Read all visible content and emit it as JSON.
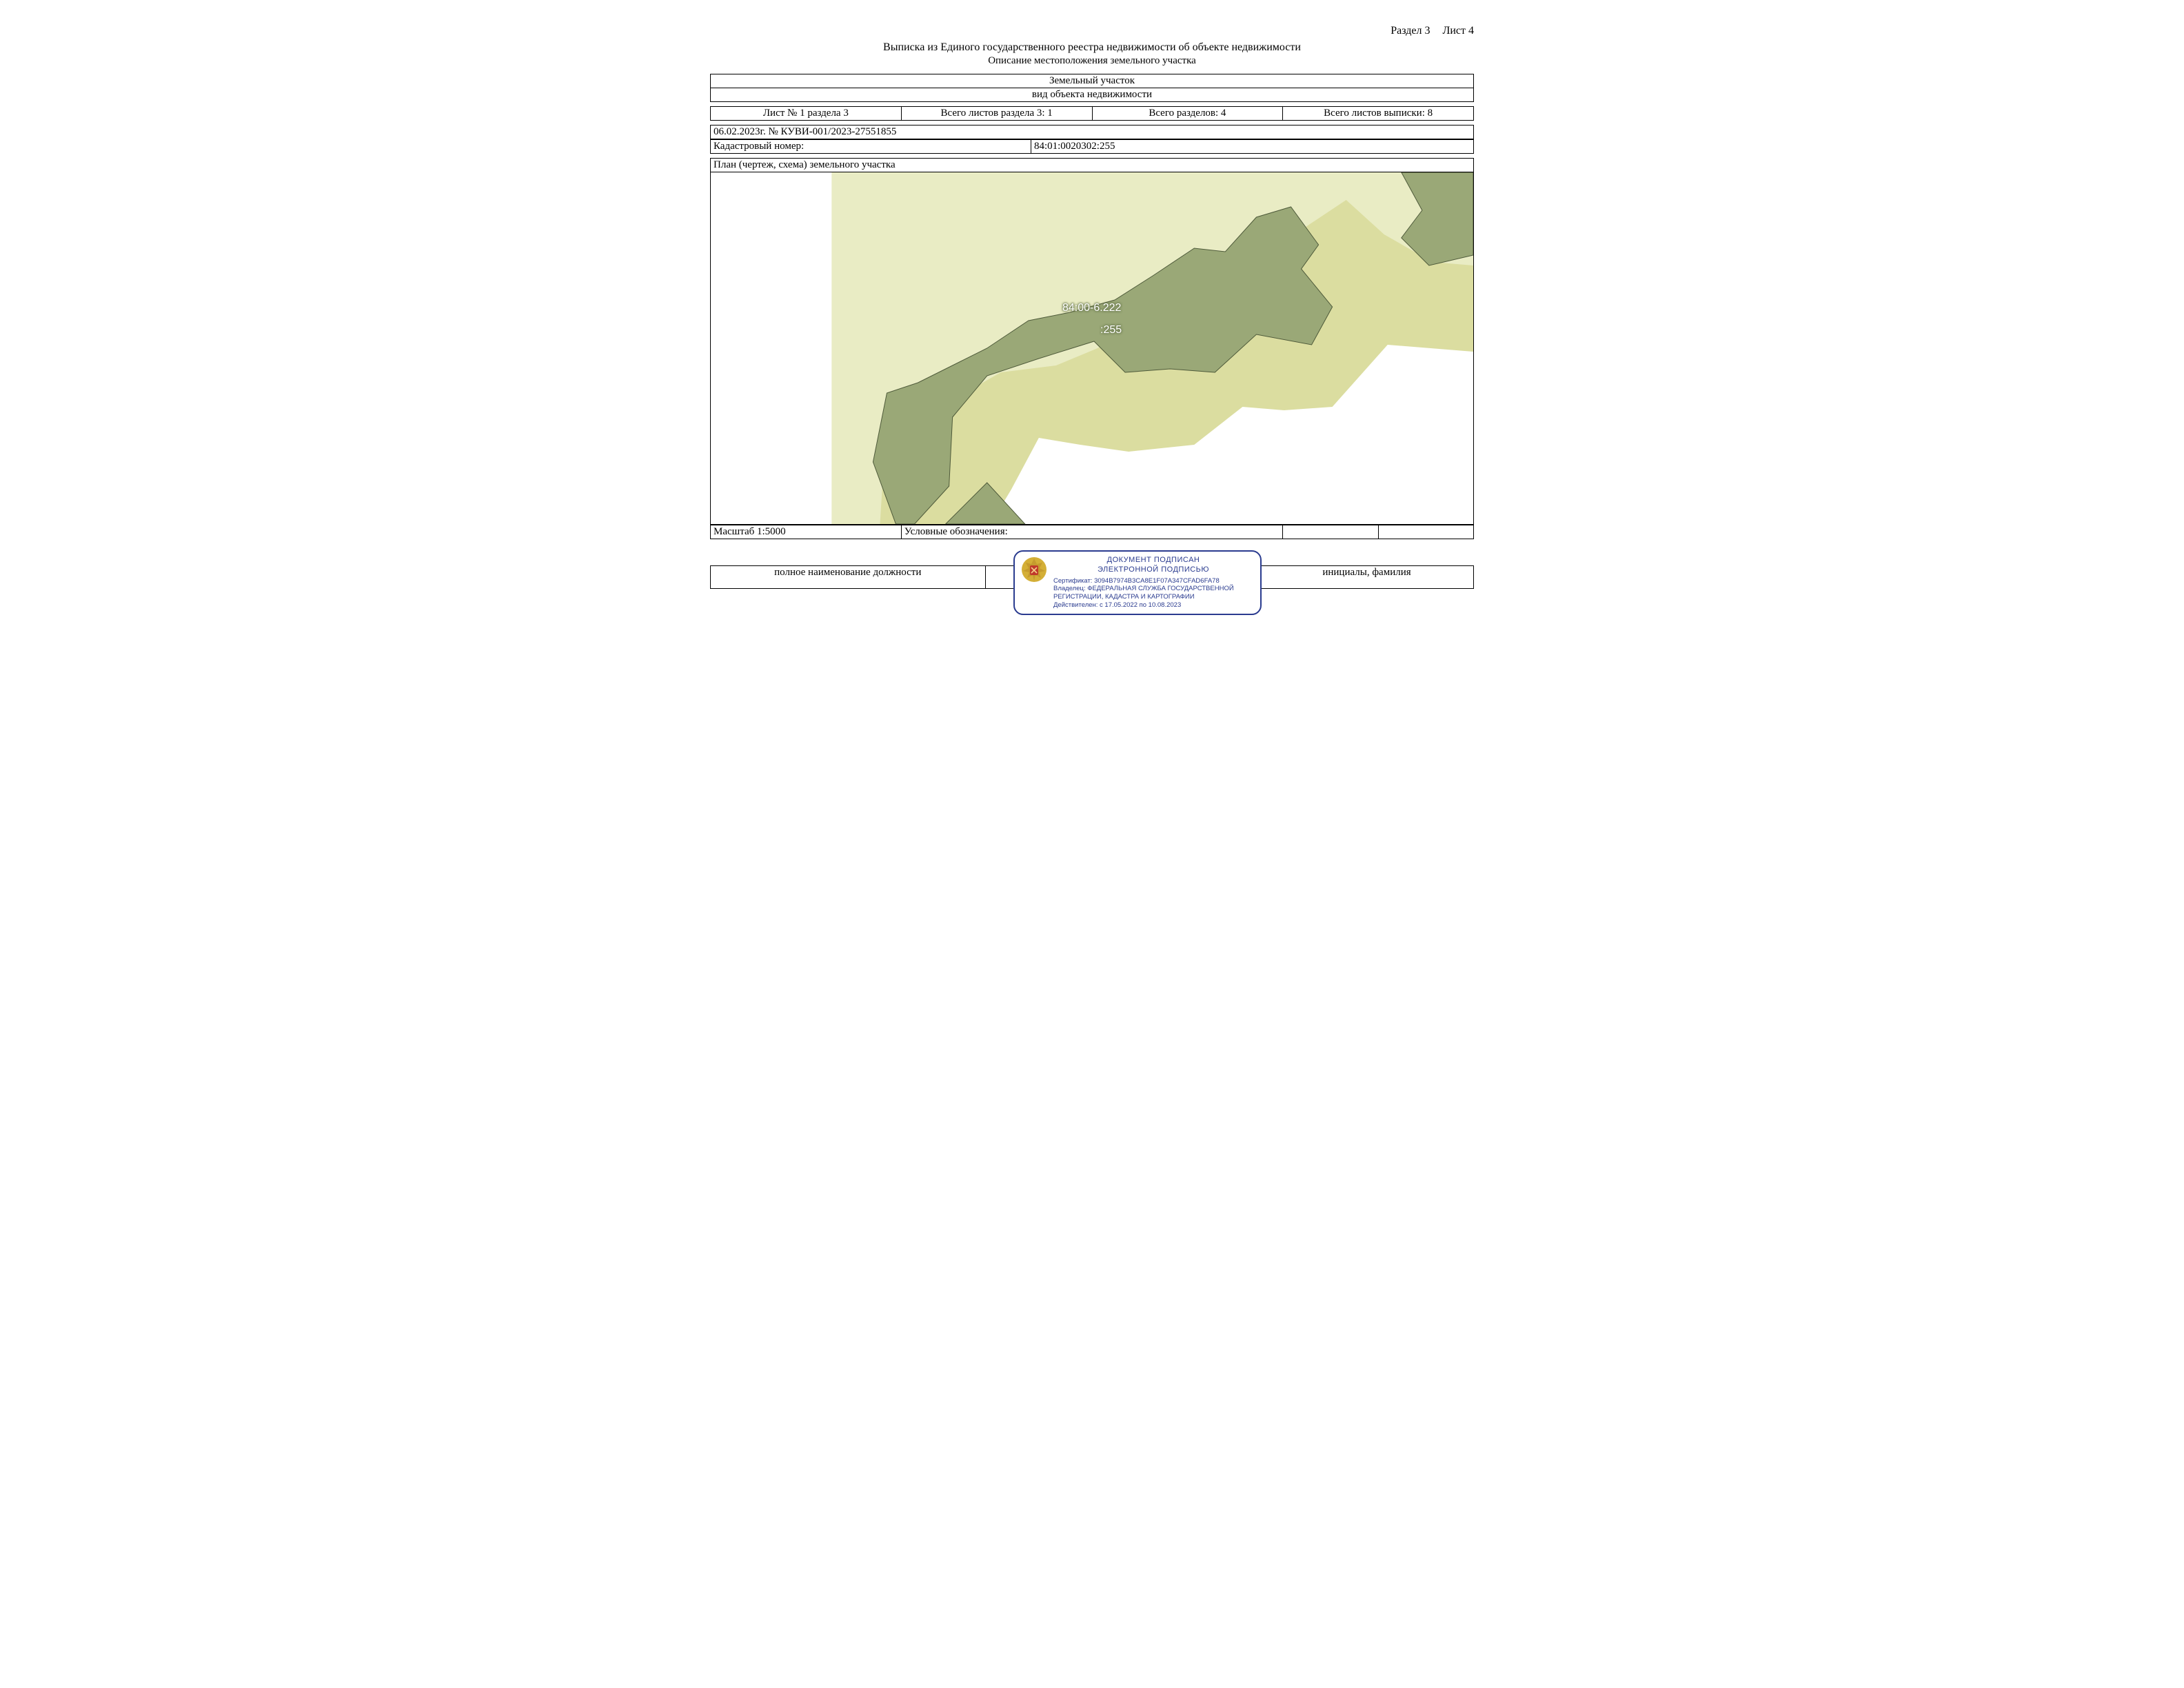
{
  "header": {
    "section": "Раздел 3",
    "sheet": "Лист 4",
    "title": "Выписка из Единого государственного реестра недвижимости об объекте недвижимости",
    "subtitle": "Описание местоположения земельного участка"
  },
  "object_rows": {
    "row1": "Земельный участок",
    "row2": "вид объекта недвижимости"
  },
  "counts": {
    "c1": "Лист № 1 раздела 3",
    "c2": "Всего листов раздела 3: 1",
    "c3": "Всего разделов: 4",
    "c4": "Всего листов выписки: 8"
  },
  "ref_line": "06.02.2023г. № КУВИ-001/2023-27551855",
  "cadastral": {
    "label": "Кадастровый номер:",
    "value": "84:01:0020302:255"
  },
  "plan": {
    "title": "План (чертеж, схема) земельного участка",
    "label_zone": "84:00-6.222",
    "label_parcel": ":255"
  },
  "scale_row": {
    "scale": "Масштаб 1:5000",
    "legend": "Условные обозначения:"
  },
  "sign_row": {
    "left": "полное наименование должности",
    "right": "инициалы, фамилия"
  },
  "stamp": {
    "line1": "ДОКУМЕНТ ПОДПИСАН",
    "line2": "ЭЛЕКТРОННОЙ ПОДПИСЬЮ",
    "cert": "Сертификат: 3094B7974B3CA8E1F07A347CFAD6FA78",
    "owner": "Владелец: ФЕДЕРАЛЬНАЯ СЛУЖБА ГОСУДАРСТВЕННОЙ РЕГИСТРАЦИИ, КАДАСТРА И КАРТОГРАФИИ",
    "valid": "Действителен: с 17.05.2022 по 10.08.2023"
  }
}
